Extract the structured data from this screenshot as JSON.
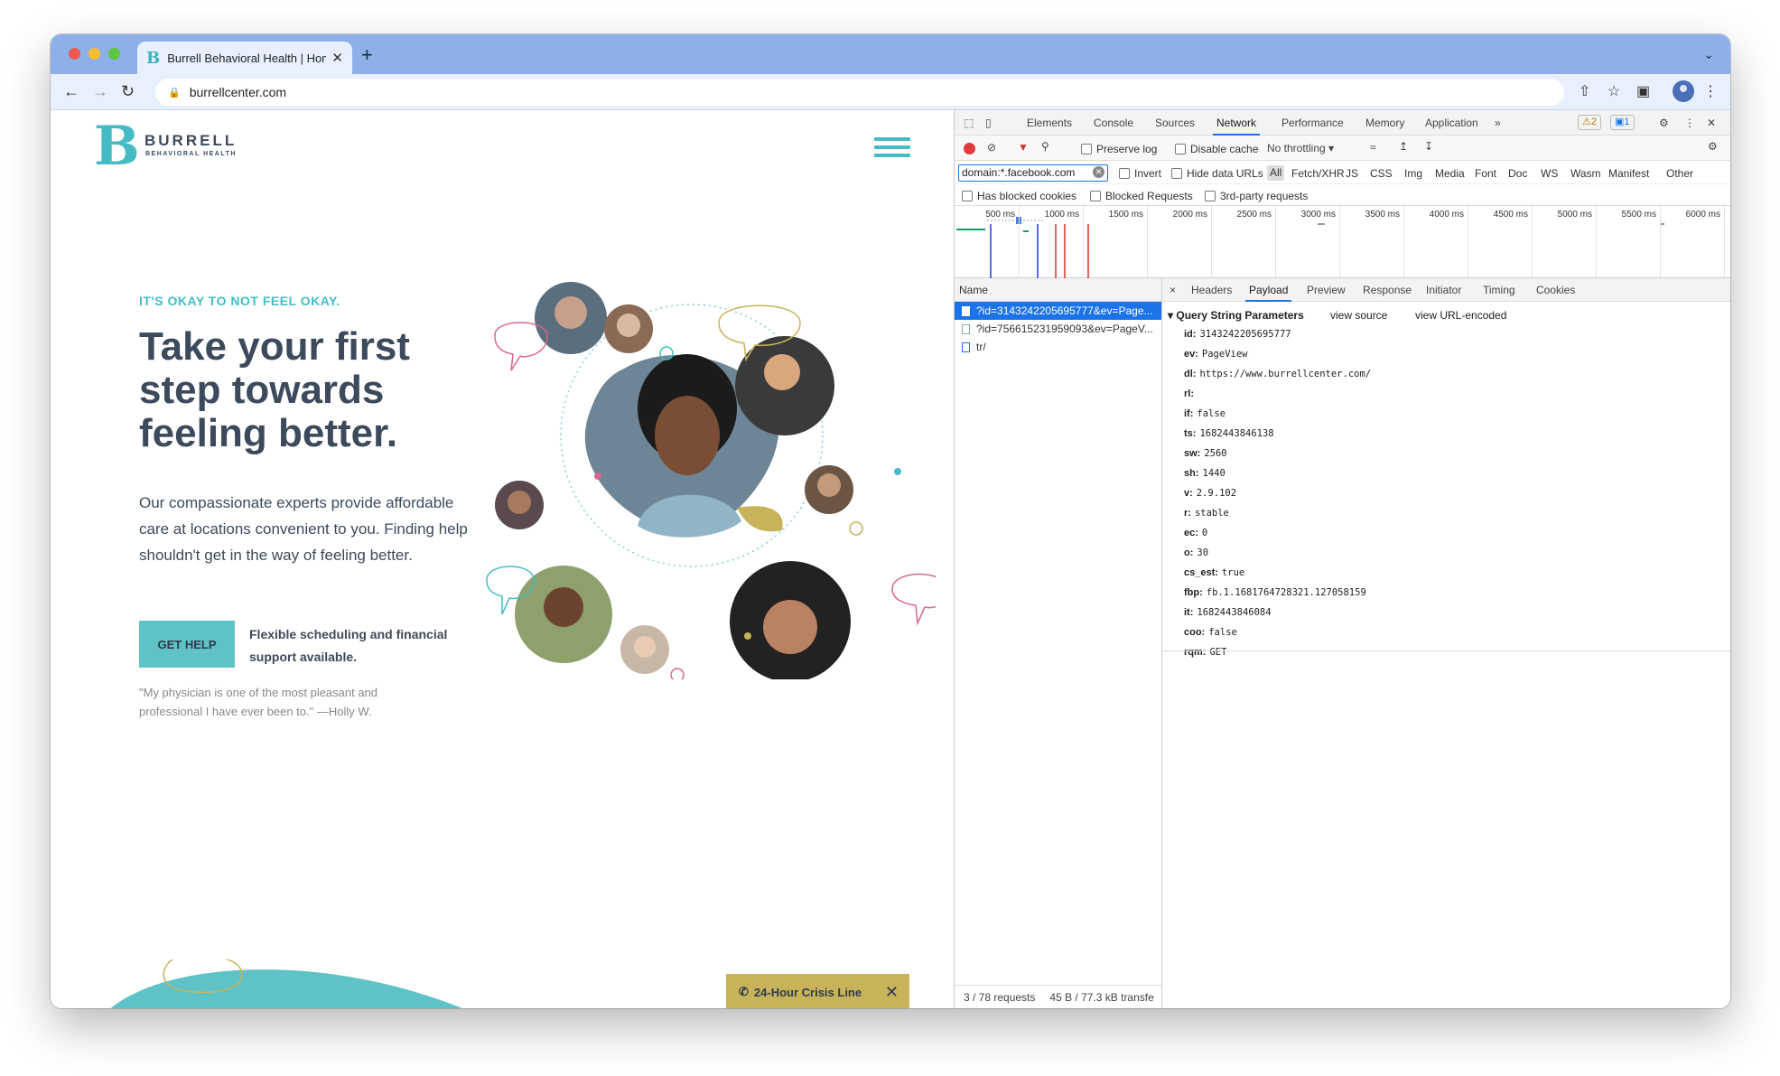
{
  "browser": {
    "tab_title": "Burrell Behavioral Health | Hom",
    "favicon": "B",
    "url": "burrellcenter.com",
    "new_tab_symbol": "+",
    "tab_close_symbol": "✕"
  },
  "page": {
    "logo_letter": "B",
    "logo_name": "BURRELL",
    "logo_sub": "BEHAVIORAL HEALTH",
    "eyebrow": "IT'S OKAY TO NOT FEEL OKAY.",
    "headline": "Take your first step towards feeling better.",
    "body": "Our compassionate experts provide affordable care at locations convenient to you. Finding help shouldn't get in the way of feeling better.",
    "cta_label": "GET HELP",
    "cta_note": "Flexible scheduling and financial support available.",
    "quote": "\"My physician is one of the most pleasant and professional I have ever been to.\" —Holly W.",
    "crisis_label": "24-Hour Crisis Line",
    "crisis_close": "✕",
    "colors": {
      "teal": "#45bcc4",
      "navy": "#3d4a5c",
      "gold": "#c8b35a",
      "pink": "#d9668f"
    }
  },
  "devtools": {
    "tabs": [
      "Elements",
      "Console",
      "Sources",
      "Network",
      "Performance",
      "Memory",
      "Application"
    ],
    "active_tab": "Network",
    "more_symbol": "»",
    "warnings_badge": "2",
    "messages_badge": "1",
    "toolbar": {
      "preserve_log": "Preserve log",
      "disable_cache": "Disable cache",
      "throttling": "No throttling"
    },
    "filter_value": "domain:*.facebook.com",
    "filter_options": {
      "invert": "Invert",
      "hide_data_urls": "Hide data URLs"
    },
    "type_filters": [
      "All",
      "Fetch/XHR",
      "JS",
      "CSS",
      "Img",
      "Media",
      "Font",
      "Doc",
      "WS",
      "Wasm",
      "Manifest",
      "Other"
    ],
    "row4": {
      "blocked_cookies": "Has blocked cookies",
      "blocked_requests": "Blocked Requests",
      "third_party": "3rd-party requests"
    },
    "timeline_ticks": [
      "500 ms",
      "1000 ms",
      "1500 ms",
      "2000 ms",
      "2500 ms",
      "3000 ms",
      "3500 ms",
      "4000 ms",
      "4500 ms",
      "5000 ms",
      "5500 ms",
      "6000 ms"
    ],
    "name_header": "Name",
    "requests": [
      "?id=3143242205695777&ev=Page...",
      "?id=756615231959093&ev=PageV...",
      "tr/"
    ],
    "footer_requests": "3 / 78 requests",
    "footer_transfer": "45 B / 77.3 kB transfe",
    "detail_tabs": [
      "Headers",
      "Payload",
      "Preview",
      "Response",
      "Initiator",
      "Timing",
      "Cookies"
    ],
    "detail_active": "Payload",
    "close_symbol": "×",
    "qsp_title": "Query String Parameters",
    "view_source": "view source",
    "view_url_encoded": "view URL-encoded",
    "params": [
      {
        "k": "id:",
        "v": "3143242205695777"
      },
      {
        "k": "ev:",
        "v": "PageView"
      },
      {
        "k": "dl:",
        "v": "https://www.burrellcenter.com/"
      },
      {
        "k": "rl:",
        "v": ""
      },
      {
        "k": "if:",
        "v": "false"
      },
      {
        "k": "ts:",
        "v": "1682443846138"
      },
      {
        "k": "sw:",
        "v": "2560"
      },
      {
        "k": "sh:",
        "v": "1440"
      },
      {
        "k": "v:",
        "v": "2.9.102"
      },
      {
        "k": "r:",
        "v": "stable"
      },
      {
        "k": "ec:",
        "v": "0"
      },
      {
        "k": "o:",
        "v": "30"
      },
      {
        "k": "cs_est:",
        "v": "true"
      },
      {
        "k": "fbp:",
        "v": "fb.1.1681764728321.127058159"
      },
      {
        "k": "it:",
        "v": "1682443846084"
      },
      {
        "k": "coo:",
        "v": "false"
      },
      {
        "k": "rqm:",
        "v": "GET"
      }
    ]
  }
}
